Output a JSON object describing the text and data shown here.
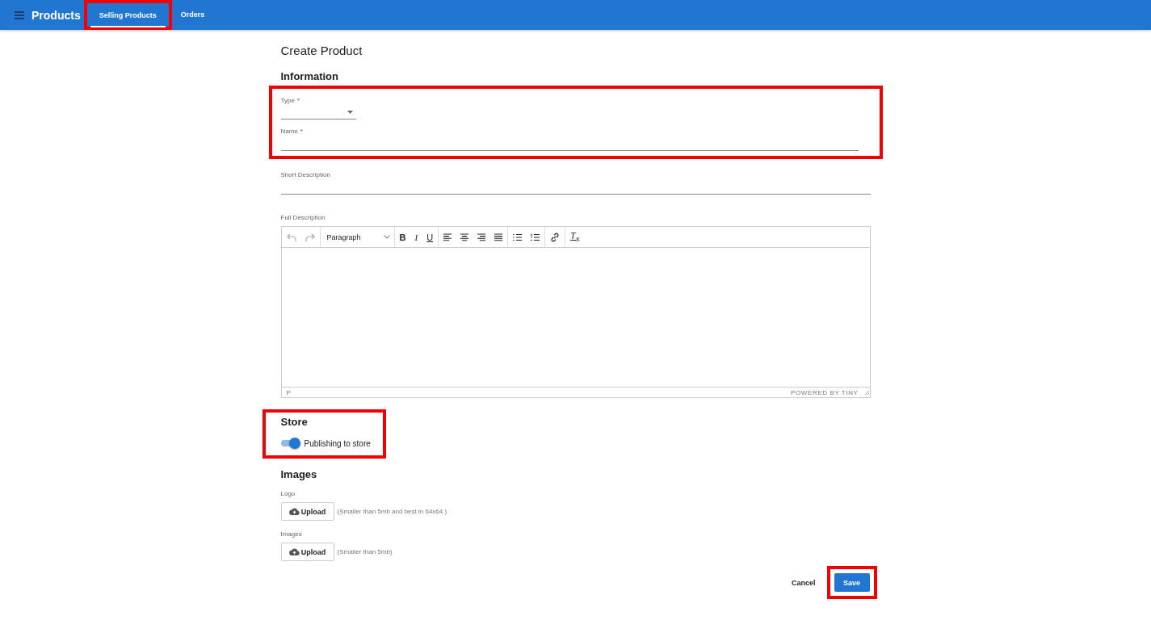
{
  "app_bar": {
    "title": "Products",
    "tabs": [
      {
        "label": "Selling Products",
        "selected": true,
        "highlighted": true
      },
      {
        "label": "Orders",
        "selected": false,
        "highlighted": false
      }
    ]
  },
  "page": {
    "title": "Create Product"
  },
  "information": {
    "heading": "Information",
    "fields": [
      {
        "kind": "select",
        "label": "Type",
        "required_mark": "*",
        "highlighted": true
      },
      {
        "kind": "text",
        "label": "Name",
        "required_mark": "*",
        "highlighted": true
      },
      {
        "kind": "text",
        "label": "Short Description",
        "highlighted": false
      }
    ],
    "editor": {
      "label": "Full Description",
      "block_format": "Paragraph",
      "format_buttons": [
        "B",
        "I",
        "U"
      ],
      "clear_format": "T$_{x}$",
      "status_path": "P",
      "branding": "POWERED BY TINY"
    }
  },
  "store": {
    "heading": "Store",
    "highlighted": true,
    "toggle": {
      "label": "Publishing to store",
      "on": true
    }
  },
  "images": {
    "heading": "Images",
    "uploads": [
      {
        "label": "Logo",
        "button": "Upload",
        "hint": "(Smaller than 5mb and best in 64x64.)"
      },
      {
        "label": "Images",
        "button": "Upload",
        "hint": "(Smaller than 5mb)"
      }
    ]
  },
  "actions": [
    {
      "kind": "text",
      "label": "Cancel",
      "highlighted": false
    },
    {
      "kind": "primary",
      "label": "Save",
      "highlighted": true
    }
  ]
}
